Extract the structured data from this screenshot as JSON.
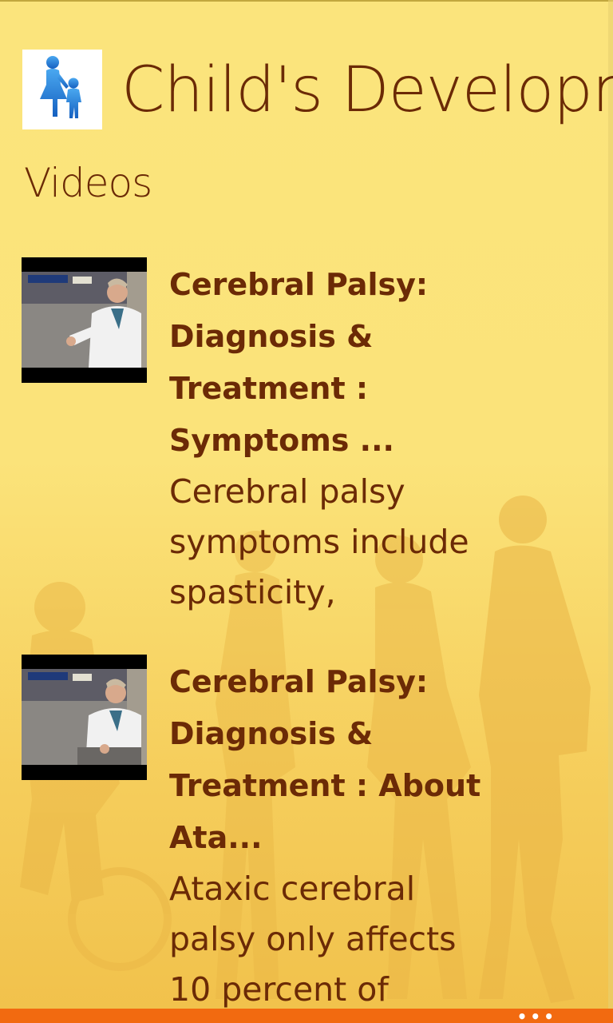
{
  "header": {
    "app_title": "Child's Development",
    "app_icon": "parent-child-icon"
  },
  "page": {
    "title": "Videos"
  },
  "videos": [
    {
      "title": "Cerebral Palsy: Diagnosis & Treatment : Symptoms ...",
      "description": "Cerebral palsy symptoms include spasticity,"
    },
    {
      "title": "Cerebral Palsy: Diagnosis & Treatment : About Ata...",
      "description": "Ataxic cerebral palsy only affects 10 percent of"
    }
  ],
  "app_bar": {
    "more_label": "•••",
    "accent_color": "#f26a10"
  },
  "colors": {
    "text": "#6b2a06",
    "background": "#fbe47c"
  }
}
